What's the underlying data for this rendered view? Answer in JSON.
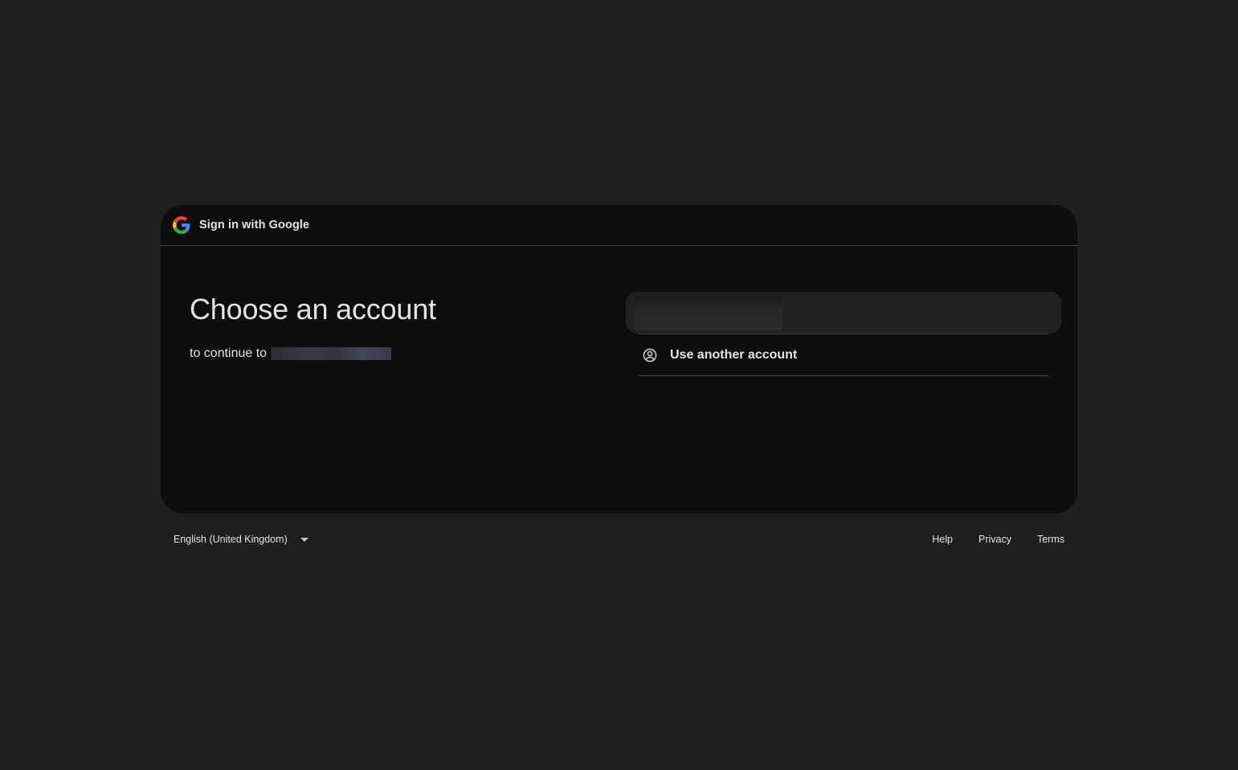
{
  "header": {
    "title": "Sign in with Google"
  },
  "main": {
    "heading": "Choose an account",
    "subtitle_prefix": "to continue to"
  },
  "accounts": {
    "use_another_label": "Use another account"
  },
  "footer": {
    "language": "English (United Kingdom)",
    "links": {
      "help": "Help",
      "privacy": "Privacy",
      "terms": "Terms"
    }
  },
  "icons": {
    "logo": "google-g-icon",
    "person": "person-circle-icon",
    "dropdown": "caret-down-icon"
  },
  "colors": {
    "background": "#1f201e",
    "card": "#0e0e0e",
    "text": "#e3e3e3",
    "divider": "#444746"
  }
}
